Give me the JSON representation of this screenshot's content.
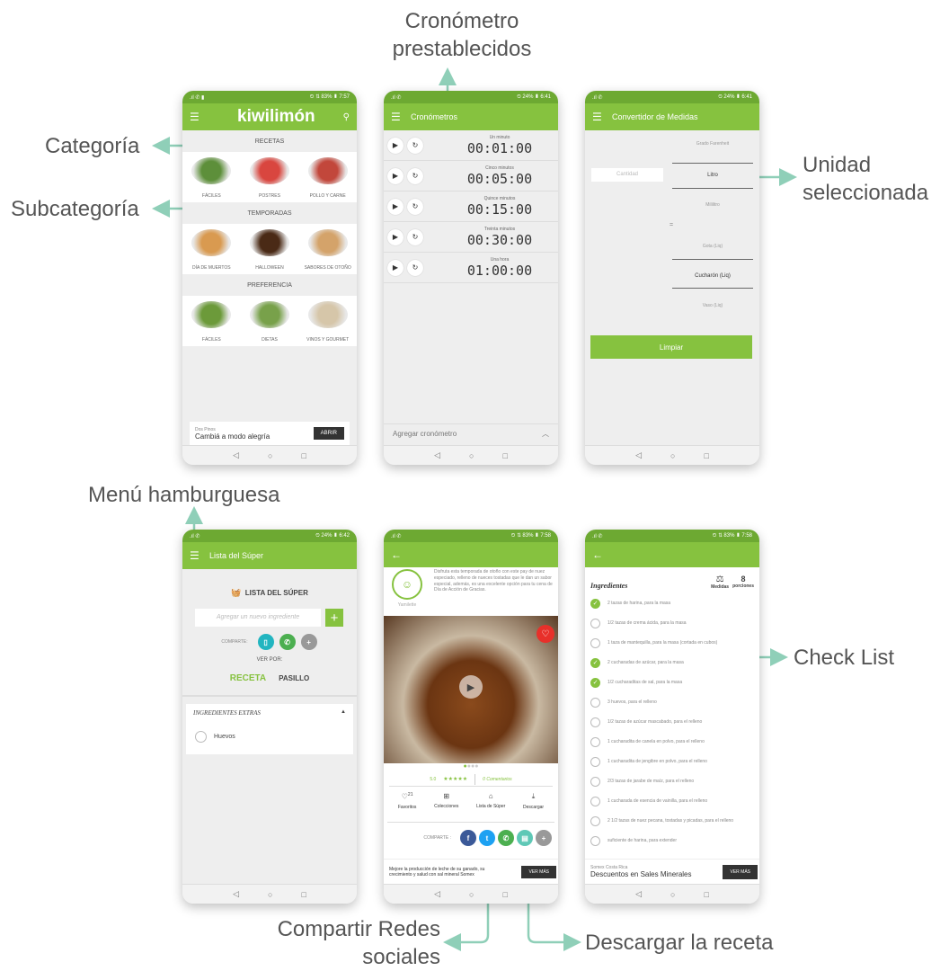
{
  "colors": {
    "green": "#86c23f",
    "dark_green": "#6da932",
    "arrow": "#8fcfb8"
  },
  "callouts": {
    "cronometro": "Cronómetro prestablecidos",
    "categoria": "Categoría",
    "subcategoria": "Subcategoría",
    "unidad": "Unidad seleccionada",
    "menu": "Menú hamburguesa",
    "checklist": "Check List",
    "compartir": "Compartir Redes sociales",
    "descargar": "Descargar la receta"
  },
  "phone1": {
    "status_right": "⏲ ⇅ 83% ▮ 7:57",
    "brand": "kiwilimón",
    "sections": [
      {
        "title": "RECETAS",
        "items": [
          "FÁCILES",
          "POSTRES",
          "POLLO Y CARNE"
        ]
      },
      {
        "title": "TEMPORADAS",
        "items": [
          "DÍA DE MUERTOS",
          "HALLOWEEN",
          "SABORES DE OTOÑO"
        ]
      },
      {
        "title": "PREFERENCIA",
        "items": [
          "FÁCILES",
          "DIETAS",
          "VINOS Y GOURMET"
        ]
      }
    ],
    "ad_brand": "Dos Pinos",
    "ad_text": "Cambiá a modo alegría",
    "ad_button": "ABRIR"
  },
  "phone2": {
    "status_right": "⏲ 24% ▮ 6:41",
    "title": "Cronómetros",
    "timers": [
      {
        "name": "Un minuto",
        "value": "00:01:00"
      },
      {
        "name": "Cinco minutos",
        "value": "00:05:00"
      },
      {
        "name": "Quince minutos",
        "value": "00:15:00"
      },
      {
        "name": "Treinta minutos",
        "value": "00:30:00"
      },
      {
        "name": "Una hora",
        "value": "01:00:00"
      }
    ],
    "add_label": "Agregar cronómetro"
  },
  "phone3": {
    "status_right": "⏲ 24% ▮ 6:41",
    "title": "Convertidor de Medidas",
    "input_placeholder": "Cantidad",
    "equals": "=",
    "units_top": [
      "Grado Farenheit",
      "Litro",
      "Mililitro"
    ],
    "units_bottom": [
      "Gota (Liq)",
      "Cucharón (Liq)",
      "Vaso (Liq)"
    ],
    "button": "Limpiar"
  },
  "phone4": {
    "status_right": "⏲ 24% ▮ 6:42",
    "title": "Lista del Súper",
    "heading": "LISTA DEL SÚPER",
    "input_placeholder": "Agregar un nuevo ingrediente",
    "share_label": "COMPARTE:",
    "view_by": "VER POR:",
    "tab_receta": "RECETA",
    "tab_pasillo": "PASILLO",
    "extras_title": "INGREDIENTES EXTRAS",
    "extra_item": "Huevos"
  },
  "phone5": {
    "status_right": "⏲ ⇅ 83% ▮ 7:58",
    "description": "Disfruta esta temporada de otoño con este pay de nuez especiado, relleno de nueces tostadas que le dan un sabor especial, además, es una excelente opción para tu cena de Día de Acción de Gracias.",
    "author": "Yamilette",
    "rating": "5.0",
    "stars": "★★★★★",
    "comments": "0 Comentarios",
    "fav_count": "21",
    "actions": [
      "Favoritos",
      "Colecciones",
      "Lista de Súper",
      "Descargar"
    ],
    "share_label": "COMPARTE :",
    "ad_text": "Mejore la producción de leche de su ganado, su crecimiento y salud con sal mineral Somex",
    "ad_button": "VER MÁS"
  },
  "phone6": {
    "status_right": "⏲ ⇅ 83% ▮ 7:58",
    "title": "Ingredientes",
    "medidas": "Medidas",
    "portions_value": "8",
    "portions_label": "porciones",
    "items": [
      {
        "text": "2 tazas de harina, para la masa",
        "checked": true
      },
      {
        "text": "1/2 tazas de crema ácida, para la masa",
        "checked": false
      },
      {
        "text": "1 taza de mantequilla, para la masa (cortada en cubos)",
        "checked": false
      },
      {
        "text": "2 cucharadas de azúcar, para la masa",
        "checked": true
      },
      {
        "text": "1/2 cucharaditas de sal, para la masa",
        "checked": true
      },
      {
        "text": "3 huevos, para el relleno",
        "checked": false
      },
      {
        "text": "1/2 tazas de azúcar mascabado, para el relleno",
        "checked": false
      },
      {
        "text": "1 cucharadita de canela en polvo, para el relleno",
        "checked": false
      },
      {
        "text": "1 cucharadita de jengibre en polvo, para el relleno",
        "checked": false
      },
      {
        "text": "2/3 tazas de jarabe de maíz, para el relleno",
        "checked": false
      },
      {
        "text": "1 cucharada de esencia de vainilla, para el relleno",
        "checked": false
      },
      {
        "text": "2 1/2 tazas de nuez pecana, tostadas y picadas, para el relleno",
        "checked": false
      },
      {
        "text": "suficiente de harina, para extender",
        "checked": false
      }
    ],
    "ad_brand": "Somex Costa Rica",
    "ad_text": "Descuentos en Sales Minerales",
    "ad_button": "VER MÁS"
  }
}
